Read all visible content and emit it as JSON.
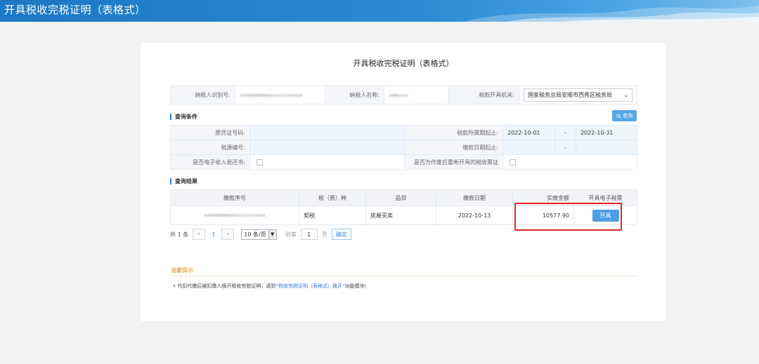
{
  "header": {
    "title": "开具税收完税证明（表格式）"
  },
  "card": {
    "title": "开具税收完税证明（表格式）"
  },
  "taxpayer": {
    "id_label": "纳税人识别号:",
    "name_label": "纳税人名称:",
    "authority_label": "税款开具机关:",
    "authority_value": "国家税务总局安顺市西秀区税务局"
  },
  "query": {
    "section_title": "查询条件",
    "button_label": "查询",
    "original_voucher_label": "原凭证号码:",
    "tax_period_label": "税款所属期起止:",
    "period_start": "2022-10-01",
    "period_dash": "-",
    "period_end": "2022-10-31",
    "tax_source_label": "税源编号:",
    "payment_date_label": "缴款日期起止:",
    "date_dash": "-",
    "refund_label": "是否电子收入退还书:",
    "reissue_label": "是否为作废后重新开具的税收票证"
  },
  "results": {
    "section_title": "查询结果",
    "columns": [
      "缴款序号",
      "税（费）种",
      "品目",
      "缴款日期",
      "实缴金额",
      "开具电子税票"
    ],
    "rows": [
      {
        "tax_type": "契税",
        "item": "房屋买卖",
        "date": "2022-10-13",
        "amount": "10577.90",
        "action": "开具"
      }
    ]
  },
  "pager": {
    "total": "共 1 条",
    "prev": "‹",
    "page": "1",
    "next": "›",
    "page_size": "10 条/页",
    "goto_label": "到第",
    "goto_value": "1",
    "page_unit": "页",
    "confirm": "确定"
  },
  "tips": {
    "title": "温馨提示",
    "text_prefix": "• 代扣代缴后被扣缴人换开税收完税证明，请到",
    "link": "“税收完税证明（表格式）换开”",
    "text_suffix": "功能模块!"
  },
  "colors": {
    "primary": "#2f7ed8",
    "button": "#4f9fe4",
    "highlight": "#e2262a",
    "tip": "#d98a17"
  },
  "icons": [
    "search-icon",
    "chevron-down-icon",
    "chevron-left-icon",
    "chevron-right-icon"
  ]
}
